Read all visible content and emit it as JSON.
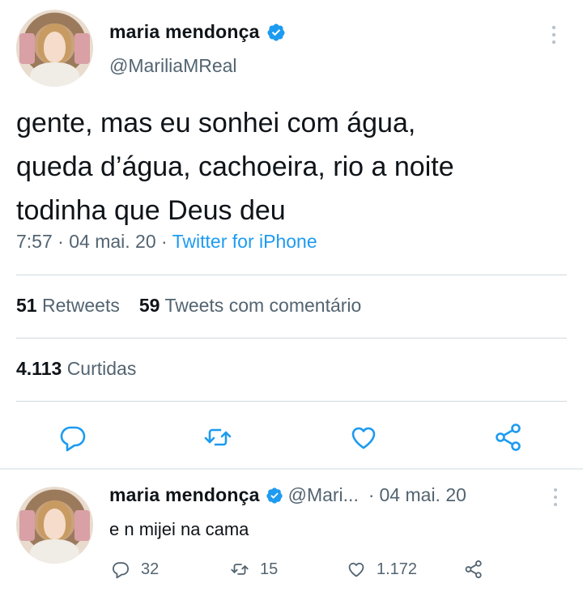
{
  "main_tweet": {
    "display_name": "maria mendonça",
    "handle": "@MariliaMReal",
    "text_lines": [
      "gente, mas eu sonhei com água,",
      "queda d’água, cachoeira, rio a noite",
      "todinha que Deus deu"
    ],
    "time": "7:57",
    "date": "04 mai. 20",
    "source": "Twitter for iPhone",
    "retweets_count": "51",
    "retweets_label": "Retweets",
    "quotes_count": "59",
    "quotes_label": "Tweets com comentário",
    "likes_count": "4.113",
    "likes_label": "Curtidas",
    "actions": [
      "reply-icon",
      "retweet-icon",
      "like-icon",
      "share-icon"
    ]
  },
  "reply_tweet": {
    "display_name": "maria mendonça",
    "handle": "@Mari...",
    "date": "04 mai. 20",
    "text": "e n mijei na cama",
    "reply_count": "32",
    "retweet_count": "15",
    "like_count": "1.172"
  },
  "colors": {
    "accent": "#1d9bf0",
    "text_primary": "#0f1419",
    "text_secondary": "#536471",
    "divider": "#cfd9de"
  }
}
